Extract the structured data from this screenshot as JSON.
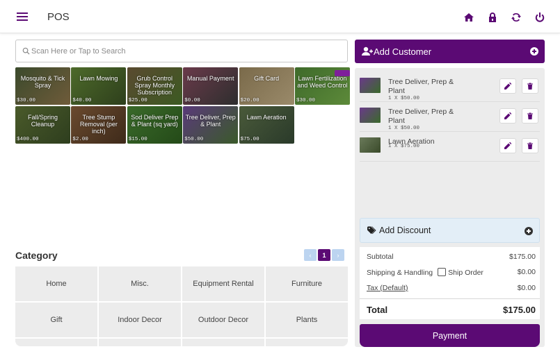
{
  "header": {
    "title": "POS",
    "icons": [
      "menu-icon",
      "home-icon",
      "lock-icon",
      "sync-icon",
      "power-icon"
    ]
  },
  "search": {
    "placeholder": "Scan Here or Tap to Search"
  },
  "products": [
    {
      "name": "Mosquito & Tick Spray",
      "price": "$30.00",
      "theme": [
        "#3b4a2c",
        "#6f5b3a"
      ]
    },
    {
      "name": "Lawn Mowing",
      "price": "$40.00",
      "theme": [
        "#4d6a2a",
        "#2e3f1c"
      ]
    },
    {
      "name": "Grub Control Spray Monthly Subscription",
      "price": "$25.00",
      "theme": [
        "#5a4a30",
        "#3c5a22"
      ]
    },
    {
      "name": "Manual Payment",
      "price": "$0.00",
      "theme": [
        "#6a3a4a",
        "#2e2e2e"
      ]
    },
    {
      "name": "Gift Card",
      "price": "$20.00",
      "theme": [
        "#7a6a4a",
        "#9a8a6a"
      ]
    },
    {
      "name": "Lawn Fertilization and Weed Control",
      "price": "$30.00",
      "theme": [
        "#3e6a2a",
        "#5d8a3a"
      ],
      "tagged": true
    },
    {
      "name": "Fall/Spring Cleanup",
      "price": "$400.00",
      "theme": [
        "#4a5a2a",
        "#2e3e1e"
      ]
    },
    {
      "name": "Tree Stump Removal (per inch)",
      "price": "$2.00",
      "theme": [
        "#6a4a2e",
        "#3e2a1a"
      ]
    },
    {
      "name": "Sod Deliver Prep & Plant (sq yard)",
      "price": "$15.00",
      "theme": [
        "#3a6a2a",
        "#244a18"
      ]
    },
    {
      "name": "Tree Deliver, Prep & Plant",
      "price": "$50.00",
      "theme": [
        "#5a3a7a",
        "#3a5a2a"
      ]
    },
    {
      "name": "Lawn Aeration",
      "price": "$75.00",
      "theme": [
        "#4a5a3a",
        "#2a3a2a"
      ]
    }
  ],
  "category": {
    "title": "Category",
    "pager": {
      "prev": "‹",
      "current": "1",
      "next": "›"
    },
    "items": [
      "Home",
      "Misc.",
      "Equipment Rental",
      "Furniture",
      "Gift",
      "Indoor Decor",
      "Outdoor Decor",
      "Plants",
      "",
      "",
      "",
      ""
    ]
  },
  "customer": {
    "add_label": "Add Customer"
  },
  "cart": {
    "items": [
      {
        "name": "Tree Deliver, Prep & Plant",
        "qty": "1 X $50.00",
        "thumb": [
          "#6a3a8a",
          "#3a6a2a"
        ]
      },
      {
        "name": "Tree Deliver, Prep & Plant",
        "qty": "1 X $50.00",
        "thumb": [
          "#6a3a8a",
          "#3a6a2a"
        ]
      },
      {
        "name": "Lawn Aeration",
        "qty": "1 X $75.00",
        "thumb": [
          "#6a7a5a",
          "#3a4a2a"
        ]
      }
    ]
  },
  "discount": {
    "label": "Add Discount"
  },
  "totals": {
    "subtotal_label": "Subtotal",
    "subtotal": "$175.00",
    "shipping_label": "Shipping & Handling",
    "ship_order_label": "Ship Order",
    "shipping": "$0.00",
    "tax_label": "Tax (Default)",
    "tax": "$0.00",
    "total_label": "Total",
    "total": "$175.00"
  },
  "payment": {
    "label": "Payment"
  },
  "colors": {
    "accent": "#5b0a74",
    "panel": "#ececec",
    "discount_bg": "#e3eef7"
  }
}
